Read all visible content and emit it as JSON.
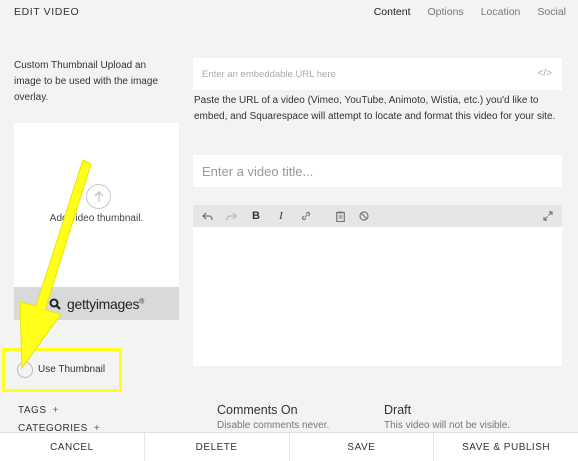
{
  "header": {
    "title": "EDIT VIDEO",
    "tabs": [
      {
        "label": "Content"
      },
      {
        "label": "Options"
      },
      {
        "label": "Location"
      },
      {
        "label": "Social"
      }
    ]
  },
  "thumbnail": {
    "heading": "Custom Thumbnail",
    "description": " Upload an image to be used with the image overlay.",
    "upload_label": "Add video thumbnail.",
    "getty_brand": "gettyimages",
    "getty_trademark": "®",
    "use_thumbnail_label": "Use Thumbnail"
  },
  "meta": {
    "tags_label": "TAGS",
    "categories_label": "CATEGORIES",
    "plus": "+"
  },
  "url_field": {
    "placeholder": "Enter an embeddable URL here",
    "code_icon": "</>",
    "help": "Paste the URL of a video (Vimeo, YouTube, Animoto, Wistia, etc.) you'd like to embed, and Squarespace will attempt to locate and format this video for your site."
  },
  "title_field": {
    "placeholder": "Enter a video title..."
  },
  "toolbar": {
    "icons": [
      "undo-icon",
      "redo-icon",
      "bold-icon",
      "italic-icon",
      "link-icon",
      "clipboard-icon",
      "clear-format-icon",
      "expand-icon"
    ]
  },
  "comments": {
    "title": "Comments On",
    "subtitle": "Disable comments never."
  },
  "status": {
    "title": "Draft",
    "subtitle": "This video will not be visible."
  },
  "footer": {
    "cancel": "CANCEL",
    "delete": "DELETE",
    "save": "SAVE",
    "save_publish": "SAVE & PUBLISH"
  },
  "colors": {
    "background": "#f3f3f3",
    "annotation_yellow": "#ffff1a",
    "toolbar": "#e6e6e6"
  }
}
